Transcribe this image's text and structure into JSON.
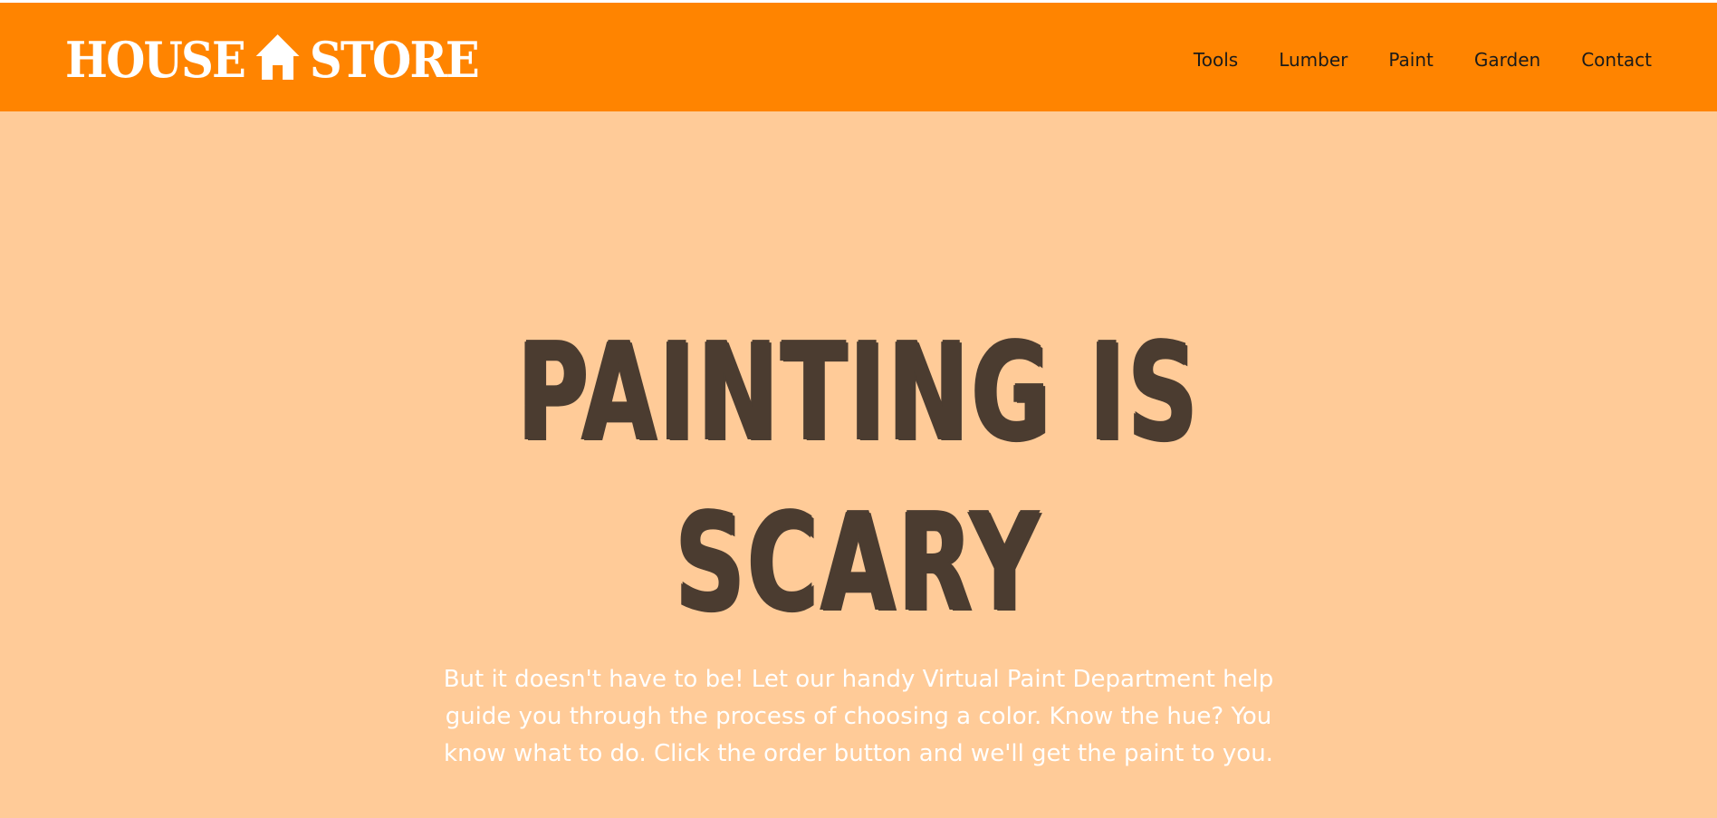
{
  "header": {
    "logo_left": "HOUSE",
    "logo_right": "STORE",
    "logo_icon": "house-icon",
    "nav": [
      {
        "label": "Tools"
      },
      {
        "label": "Lumber"
      },
      {
        "label": "Paint"
      },
      {
        "label": "Garden"
      },
      {
        "label": "Contact"
      }
    ]
  },
  "hero": {
    "title_line1": "PAINTING IS",
    "title_line2": "SCARY",
    "body": "But it doesn't have to be! Let our handy Virtual Paint Department help guide you through the process of choosing a color. Know the hue? You know what to do. Click the order button and we'll get the paint to you."
  },
  "colors": {
    "header_bg": "#ff8400",
    "page_bg": "#ffcb98",
    "title": "#4b3c30",
    "body_text": "#ffffff"
  }
}
